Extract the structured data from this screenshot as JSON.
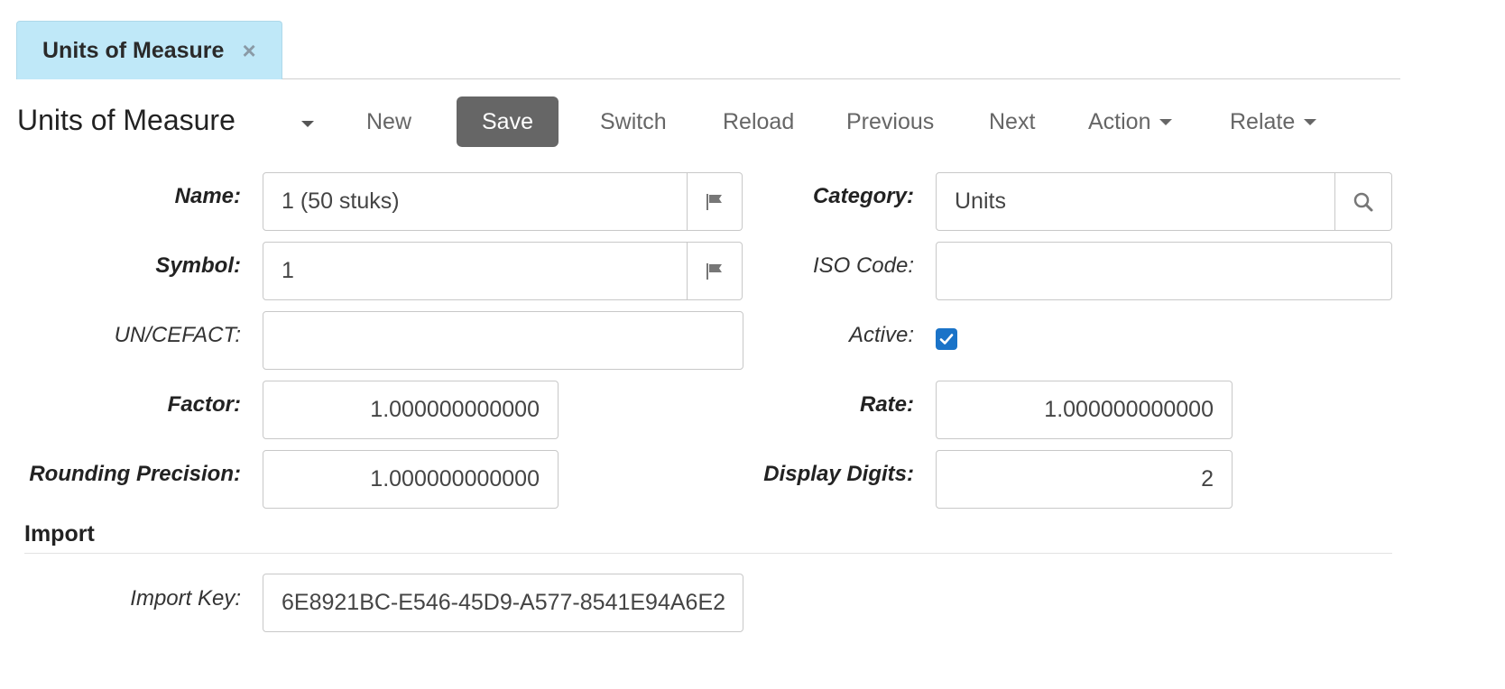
{
  "tab": {
    "label": "Units of Measure",
    "close": "×"
  },
  "toolbar": {
    "title": "Units of Measure",
    "new": "New",
    "save": "Save",
    "switch": "Switch",
    "reload": "Reload",
    "previous": "Previous",
    "next": "Next",
    "action": "Action",
    "relate": "Relate"
  },
  "form": {
    "name": {
      "label": "Name:",
      "value": "1 (50 stuks)"
    },
    "symbol": {
      "label": "Symbol:",
      "value": "1"
    },
    "uncefact": {
      "label": "UN/CEFACT:",
      "value": ""
    },
    "factor": {
      "label": "Factor:",
      "value": "1.000000000000"
    },
    "rounding": {
      "label": "Rounding Precision:",
      "value": "1.000000000000"
    },
    "category": {
      "label": "Category:",
      "value": "Units"
    },
    "iso_code": {
      "label": "ISO Code:",
      "value": ""
    },
    "active": {
      "label": "Active:",
      "checked": true
    },
    "rate": {
      "label": "Rate:",
      "value": "1.000000000000"
    },
    "display_digits": {
      "label": "Display Digits:",
      "value": "2"
    }
  },
  "import": {
    "section_title": "Import",
    "import_key": {
      "label": "Import Key:",
      "value": "6E8921BC-E546-45D9-A577-8541E94A6E2"
    }
  },
  "icons": {
    "translate": "flag-icon",
    "search": "search-icon",
    "checkbox": "check-icon",
    "close": "close-icon"
  },
  "colors": {
    "tab_bg": "#bfe8f8",
    "save_bg": "#666666",
    "checkbox": "#1a73c8"
  }
}
